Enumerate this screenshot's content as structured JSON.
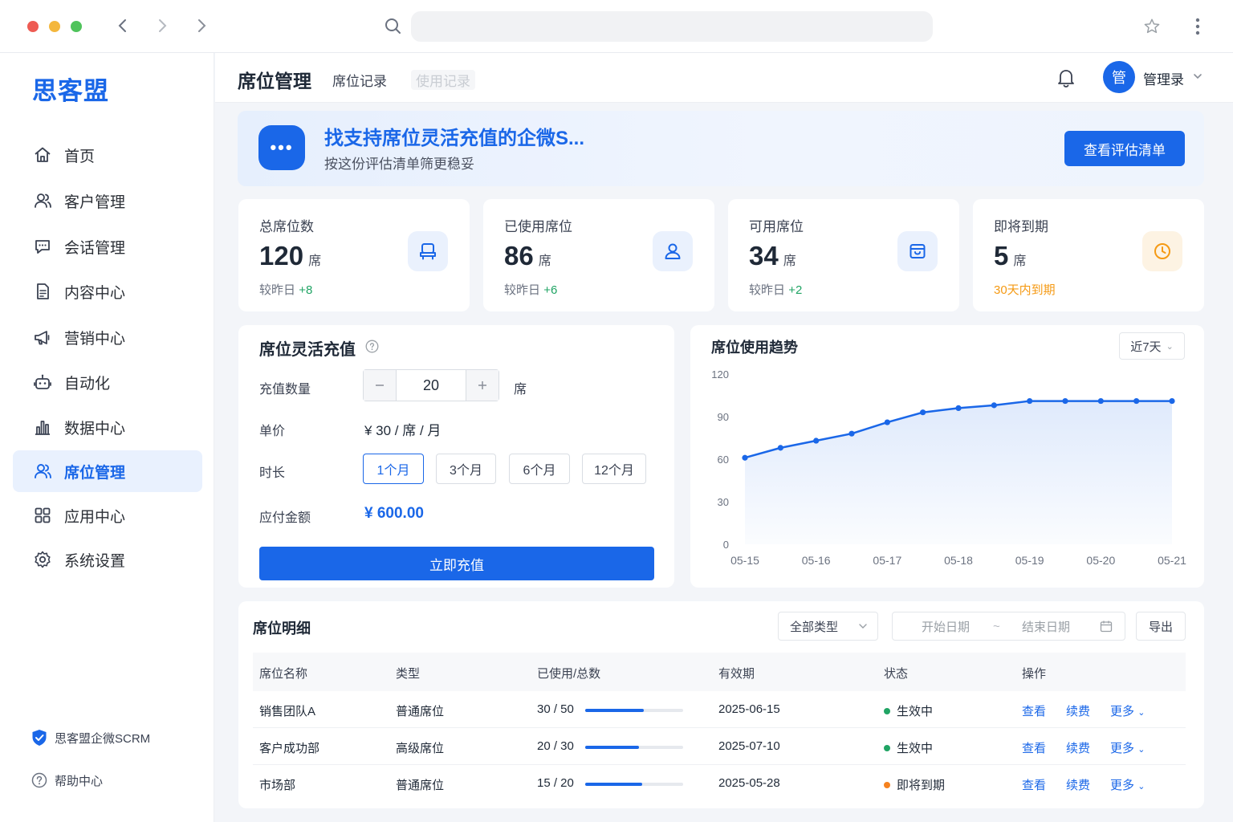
{
  "sidebar": {
    "logo": "思客盟",
    "items": [
      {
        "label": "首页",
        "icon": "home-icon"
      },
      {
        "label": "客户管理",
        "icon": "users-icon"
      },
      {
        "label": "会话管理",
        "icon": "chat-icon"
      },
      {
        "label": "内容中心",
        "icon": "document-icon"
      },
      {
        "label": "营销中心",
        "icon": "megaphone-icon"
      },
      {
        "label": "自动化",
        "icon": "robot-icon"
      },
      {
        "label": "数据中心",
        "icon": "bar-chart-icon"
      },
      {
        "label": "席位管理",
        "icon": "seat-users-icon",
        "active": true
      },
      {
        "label": "应用中心",
        "icon": "grid-icon"
      },
      {
        "label": "系统设置",
        "icon": "gear-icon"
      }
    ],
    "footer_brand": "思客盟企微SCRM",
    "help": "帮助中心"
  },
  "header": {
    "title": "席位管理",
    "tabs": [
      "席位记录",
      "使用记录"
    ],
    "user_avatar": "管",
    "user_name": "管理录"
  },
  "banner": {
    "badge": "•••",
    "title": "找支持席位灵活充值的企微S...",
    "subtitle": "按这份评估清单筛更稳妥",
    "button": "查看评估清单"
  },
  "stats": [
    {
      "label": "总席位数",
      "value": "120",
      "unit": "席",
      "foot_prefix": "较昨日",
      "foot_delta": "+8",
      "icon": "seat-icon"
    },
    {
      "label": "已使用席位",
      "value": "86",
      "unit": "席",
      "foot_prefix": "较昨日",
      "foot_delta": "+6",
      "icon": "user-icon"
    },
    {
      "label": "可用席位",
      "value": "34",
      "unit": "席",
      "foot_prefix": "较昨日",
      "foot_delta": "+2",
      "icon": "box-icon"
    },
    {
      "label": "即将到期",
      "value": "5",
      "unit": "席",
      "foot_warn": "30天内到期",
      "icon": "clock-icon"
    }
  ],
  "recharge": {
    "title": "席位灵活充值",
    "qty_label": "充值数量",
    "qty_value": "20",
    "qty_unit": "席",
    "price_label": "单价",
    "price_value": "¥  30 / 席 / 月",
    "duration_label": "时长",
    "durations": [
      "1个月",
      "3个月",
      "6个月",
      "12个月"
    ],
    "selected_duration": "1个月",
    "amount_label": "应付金额",
    "amount_value": "¥ 600.00",
    "submit": "立即充值"
  },
  "trend": {
    "title": "席位使用趋势",
    "range": "近7天"
  },
  "chart_data": {
    "type": "area",
    "title": "席位使用趋势",
    "x": [
      "05-15",
      "05-16",
      "05-17",
      "05-18",
      "05-19",
      "05-20",
      "05-21"
    ],
    "points_x": [
      0,
      0.5,
      1,
      1.5,
      2,
      2.5,
      3,
      3.5,
      4,
      4.5,
      5,
      5.5,
      6
    ],
    "values": [
      61,
      68,
      73,
      78,
      86,
      93,
      96,
      98,
      101,
      101,
      101,
      101,
      101
    ],
    "yticks": [
      0,
      30,
      60,
      90,
      120
    ],
    "ylim": [
      0,
      120
    ],
    "grid": false,
    "color": "#1a67e8"
  },
  "detail": {
    "title": "席位明细",
    "type_filter": "全部类型",
    "start_placeholder": "开始日期",
    "range_sep": "~",
    "end_placeholder": "结束日期",
    "export": "导出",
    "columns": [
      "席位名称",
      "类型",
      "已使用/总数",
      "有效期",
      "状态",
      "操作"
    ],
    "rows": [
      {
        "name": "销售团队A",
        "type": "普通席位",
        "usage": "30 / 50",
        "ratio": 0.6,
        "expiry": "2025-06-15",
        "status": "生效中",
        "status_color": "#20a464",
        "a1": "查看",
        "a2": "续费",
        "a3": "更多"
      },
      {
        "name": "客户成功部",
        "type": "高级席位",
        "usage": "20 / 30",
        "ratio": 0.55,
        "expiry": "2025-07-10",
        "status": "生效中",
        "status_color": "#20a464",
        "a1": "查看",
        "a2": "续费",
        "a3": "更多"
      },
      {
        "name": "市场部",
        "type": "普通席位",
        "usage": "15 / 20",
        "ratio": 0.58,
        "expiry": "2025-05-28",
        "status": "即将到期",
        "status_color": "#f5821f",
        "a1": "查看",
        "a2": "续费",
        "a3": "更多"
      }
    ]
  }
}
